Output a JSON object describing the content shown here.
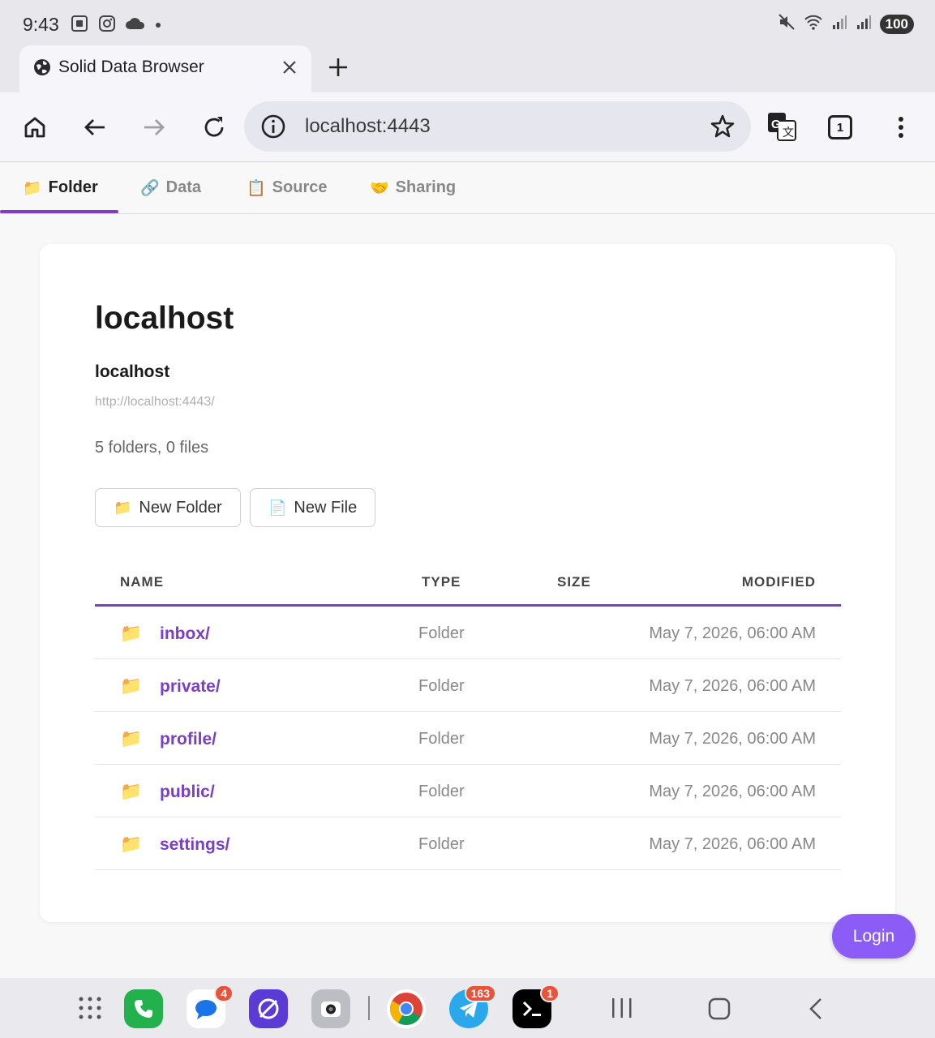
{
  "status": {
    "time": "9:43",
    "battery": "100"
  },
  "browser": {
    "tab_title": "Solid Data Browser",
    "url": "localhost:4443",
    "tab_count": "1"
  },
  "app_tabs": [
    {
      "icon": "📁",
      "label": "Folder"
    },
    {
      "icon": "🔗",
      "label": "Data"
    },
    {
      "icon": "📋",
      "label": "Source"
    },
    {
      "icon": "🤝",
      "label": "Sharing"
    }
  ],
  "card": {
    "title": "localhost",
    "subtitle": "localhost",
    "url": "http://localhost:4443/",
    "count": "5 folders, 0 files",
    "new_folder": {
      "icon": "📁",
      "label": "New Folder"
    },
    "new_file": {
      "icon": "📄",
      "label": "New File"
    }
  },
  "table": {
    "headers": {
      "name": "NAME",
      "type": "TYPE",
      "size": "SIZE",
      "modified": "MODIFIED"
    },
    "rows": [
      {
        "icon": "📁",
        "name": "inbox/",
        "type": "Folder",
        "size": "",
        "modified": "May 7, 2026, 06:00 AM"
      },
      {
        "icon": "📁",
        "name": "private/",
        "type": "Folder",
        "size": "",
        "modified": "May 7, 2026, 06:00 AM"
      },
      {
        "icon": "📁",
        "name": "profile/",
        "type": "Folder",
        "size": "",
        "modified": "May 7, 2026, 06:00 AM"
      },
      {
        "icon": "📁",
        "name": "public/",
        "type": "Folder",
        "size": "",
        "modified": "May 7, 2026, 06:00 AM"
      },
      {
        "icon": "📁",
        "name": "settings/",
        "type": "Folder",
        "size": "",
        "modified": "May 7, 2026, 06:00 AM"
      }
    ]
  },
  "login_label": "Login",
  "dock": {
    "messages_badge": "4",
    "telegram_badge": "163",
    "terminal_badge": "1"
  },
  "colors": {
    "accent": "#7b3fc4",
    "login": "#8b5cf6"
  }
}
